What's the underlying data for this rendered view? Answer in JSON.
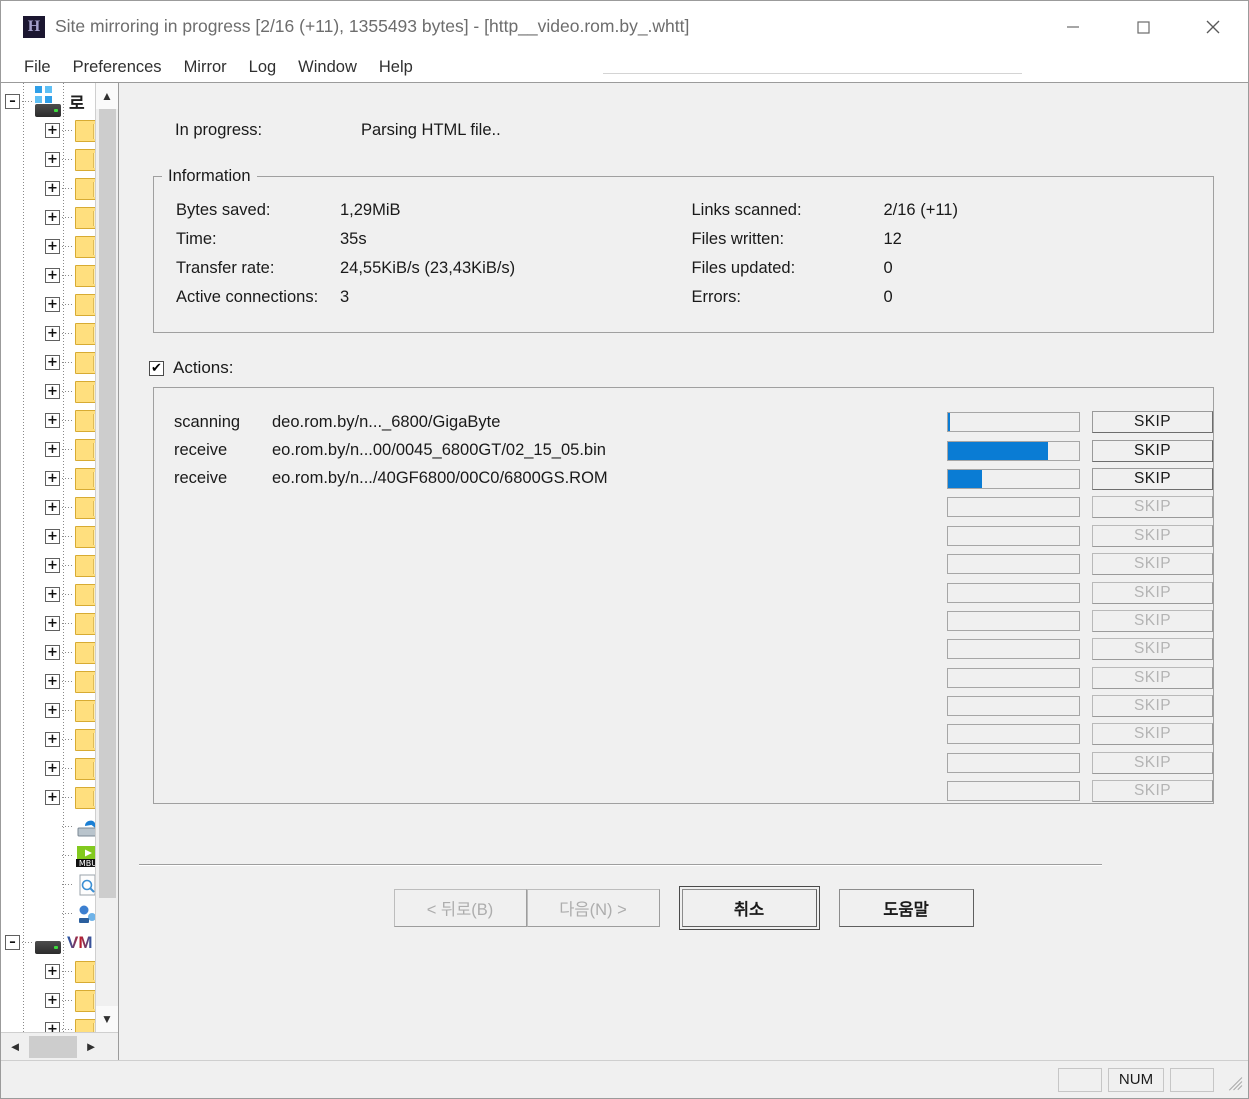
{
  "window": {
    "title": "Site mirroring in progress [2/16 (+11), 1355493 bytes] - [http__video.rom.by_.whtt]",
    "app_icon": "H",
    "controls": {
      "minimize": "minimize-icon",
      "maximize": "maximize-icon",
      "close": "close-icon"
    }
  },
  "menubar": {
    "items": [
      {
        "label": "File"
      },
      {
        "label": "Preferences"
      },
      {
        "label": "Mirror"
      },
      {
        "label": "Log"
      },
      {
        "label": "Window"
      },
      {
        "label": "Help"
      }
    ]
  },
  "sidebar": {
    "roots": [
      {
        "label": "로",
        "icon": "computer-icon",
        "expanded": true
      },
      {
        "label": "VM",
        "icon": "server-icon",
        "expanded": true
      }
    ],
    "scroll_up": "▲",
    "scroll_down": "▼",
    "scroll_left": "◄",
    "scroll_right": "►",
    "special_icons": [
      "refresh-icon",
      "mbu-media-icon",
      "document-search-icon",
      "network-icon"
    ],
    "group_a_folders": 24,
    "group_b_folders": 4
  },
  "main": {
    "in_progress": {
      "label": "In progress:",
      "value": "Parsing HTML file.."
    },
    "information": {
      "legend": "Information",
      "left": [
        {
          "key": "Bytes saved:",
          "value": "1,29MiB"
        },
        {
          "key": "Time:",
          "value": "35s"
        },
        {
          "key": "Transfer rate:",
          "value": "24,55KiB/s (23,43KiB/s)"
        },
        {
          "key": "Active connections:",
          "value": "3"
        }
      ],
      "right": [
        {
          "key": "Links scanned:",
          "value": "2/16 (+11)"
        },
        {
          "key": "Files written:",
          "value": "12"
        },
        {
          "key": "Files updated:",
          "value": "0"
        },
        {
          "key": "Errors:",
          "value": "0"
        }
      ]
    },
    "actions": {
      "label": "Actions:",
      "checked": true,
      "checkmark": "✔",
      "skip_label": "SKIP",
      "progress_color": "#0a7cd4",
      "rows": [
        {
          "op": "scanning",
          "url": "deo.rom.by/n..._6800/GigaByte",
          "progress": 2,
          "enabled": true
        },
        {
          "op": "receive",
          "url": "eo.rom.by/n...00/0045_6800GT/02_15_05.bin",
          "progress": 76,
          "enabled": true
        },
        {
          "op": "receive",
          "url": "eo.rom.by/n.../40GF6800/00C0/6800GS.ROM",
          "progress": 26,
          "enabled": true
        },
        {
          "op": "",
          "url": "",
          "progress": 0,
          "enabled": false
        },
        {
          "op": "",
          "url": "",
          "progress": 0,
          "enabled": false
        },
        {
          "op": "",
          "url": "",
          "progress": 0,
          "enabled": false
        },
        {
          "op": "",
          "url": "",
          "progress": 0,
          "enabled": false
        },
        {
          "op": "",
          "url": "",
          "progress": 0,
          "enabled": false
        },
        {
          "op": "",
          "url": "",
          "progress": 0,
          "enabled": false
        },
        {
          "op": "",
          "url": "",
          "progress": 0,
          "enabled": false
        },
        {
          "op": "",
          "url": "",
          "progress": 0,
          "enabled": false
        },
        {
          "op": "",
          "url": "",
          "progress": 0,
          "enabled": false
        },
        {
          "op": "",
          "url": "",
          "progress": 0,
          "enabled": false
        },
        {
          "op": "",
          "url": "",
          "progress": 0,
          "enabled": false
        }
      ]
    },
    "buttons": {
      "back": "< 뒤로(B)",
      "next": "다음(N) >",
      "cancel": "취소",
      "help": "도움말"
    }
  },
  "statusbar": {
    "panels": [
      "",
      "NUM",
      ""
    ]
  }
}
